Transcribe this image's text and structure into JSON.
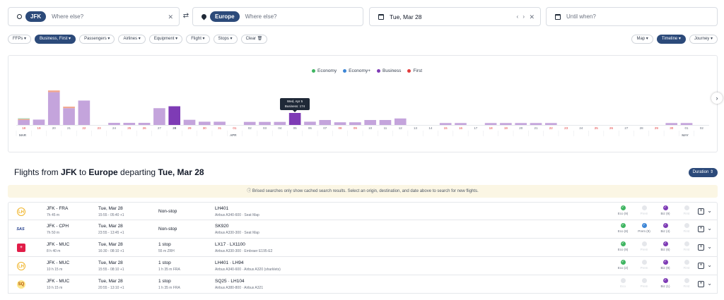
{
  "search": {
    "origin_chip": "JFK",
    "origin_placeholder": "Where else?",
    "dest_chip": "Europe",
    "dest_placeholder": "Where else?",
    "date_value": "Tue, Mar 28",
    "date_arrows": "‹ ›",
    "until_placeholder": "Until when?"
  },
  "filters": [
    "FFPs",
    "Business, First",
    "Passengers",
    "Airlines",
    "Equipment",
    "Flight",
    "Stops",
    "Clear"
  ],
  "views": [
    "Map",
    "Timeline",
    "Journey"
  ],
  "colors": {
    "economy": "#3fb561",
    "economy_plus": "#3d86d6",
    "business": "#7e3bb5",
    "first": "#e23c3c",
    "accent": "#2c4a7a"
  },
  "chart_data": {
    "type": "bar",
    "legend": [
      "Economy",
      "Economy+",
      "Business",
      "First"
    ],
    "categories": [
      "18",
      "19",
      "20",
      "21",
      "22",
      "23",
      "24",
      "25",
      "26",
      "27",
      "28",
      "29",
      "30",
      "31",
      "01",
      "02",
      "03",
      "04",
      "05",
      "06",
      "07",
      "08",
      "09",
      "10",
      "11",
      "12",
      "13",
      "14",
      "15",
      "16",
      "17",
      "18",
      "19",
      "20",
      "21",
      "22",
      "23",
      "24",
      "25",
      "26",
      "27",
      "28",
      "29",
      "30",
      "01",
      "02"
    ],
    "red_days": [
      "18",
      "19",
      "25",
      "26",
      "31",
      "01",
      "08",
      "09",
      "15",
      "16",
      "22",
      "23",
      "29",
      "30"
    ],
    "selected": "28",
    "highlight": "05",
    "month_labels": [
      {
        "at": "18",
        "text": "MAR"
      },
      {
        "at": "01",
        "text": "APR"
      },
      {
        "at": "01b",
        "text": "MAY"
      }
    ],
    "series": [
      {
        "name": "Business",
        "values": [
          26,
          28,
          172,
          88,
          128,
          0,
          11,
          11,
          11,
          88,
          98,
          27,
          17,
          17,
          0,
          16,
          16,
          16,
          63,
          17,
          26,
          14,
          14,
          26,
          26,
          34,
          0,
          0,
          10,
          10,
          0,
          10,
          10,
          10,
          10,
          10,
          0,
          0,
          0,
          0,
          0,
          0,
          0,
          10,
          10,
          0
        ]
      },
      {
        "name": "First",
        "values": [
          5,
          0,
          9,
          8,
          0,
          0,
          0,
          0,
          0,
          0,
          0,
          0,
          0,
          0,
          0,
          0,
          0,
          0,
          0,
          0,
          0,
          0,
          0,
          0,
          0,
          0,
          0,
          0,
          0,
          0,
          0,
          0,
          0,
          0,
          0,
          0,
          0,
          0,
          0,
          0,
          0,
          0,
          0,
          0,
          0,
          0
        ]
      },
      {
        "name": "Economy",
        "values": [
          4,
          0,
          0,
          0,
          0,
          0,
          0,
          0,
          0,
          0,
          0,
          0,
          0,
          0,
          0,
          0,
          0,
          0,
          0,
          0,
          0,
          0,
          0,
          0,
          0,
          0,
          0,
          0,
          0,
          0,
          0,
          0,
          0,
          0,
          0,
          0,
          0,
          0,
          0,
          0,
          0,
          0,
          0,
          0,
          0,
          0
        ]
      }
    ],
    "ylim": [
      0,
      190
    ]
  },
  "tooltip": {
    "line1": "Wed, Apr 5",
    "line2": "Business: 174"
  },
  "results": {
    "prefix": "Flights from ",
    "origin": "JFK",
    "mid": " to ",
    "dest": "Europe",
    "mid2": " departing ",
    "date": "Tue, Mar 28",
    "sort_label": "Duration"
  },
  "notice": "Brised searches only show cached search results. Select an origin, destination, and date above to search for new flights.",
  "flights": [
    {
      "logo": "LH",
      "logo_class": "lh",
      "route": "JFK - FRA",
      "duration": "7h 45 m",
      "date": "Tue, Mar 28",
      "times": "15:55 - 05:40 +1",
      "stops": "Non-stop",
      "stop_detail": "",
      "flight": "LH401",
      "equip": "Airbus A340-600  ·  Seat Map",
      "cabins": [
        {
          "label": "Eco (9)",
          "cls": "g",
          "on": true
        },
        {
          "label": "Prem",
          "cls": "b",
          "on": false
        },
        {
          "label": "Biz (9)",
          "cls": "p",
          "on": true
        },
        {
          "label": "First",
          "cls": "p",
          "on": false
        }
      ]
    },
    {
      "logo": "SAS",
      "logo_class": "sas",
      "route": "JFK - CPH",
      "duration": "7h 50 m",
      "date": "Tue, Mar 28",
      "times": "23:55 - 13:45 +1",
      "stops": "Non-stop",
      "stop_detail": "",
      "flight": "SK920",
      "equip": "Airbus A330-300  ·  Seat Map",
      "cabins": [
        {
          "label": "Eco (8)",
          "cls": "g",
          "on": true
        },
        {
          "label": "Prem (9)",
          "cls": "b",
          "on": true
        },
        {
          "label": "Biz (4)",
          "cls": "p",
          "on": true
        },
        {
          "label": "First",
          "cls": "p",
          "on": false
        }
      ]
    },
    {
      "logo": "+",
      "logo_class": "lx",
      "route": "JFK - MUC",
      "duration": "8 h 40 m",
      "date": "Tue, Mar 28",
      "times": "16:30 - 08:10 +1",
      "stops": "1 stop",
      "stop_detail": "55 m ZRH",
      "flight": "LX17  ·  LX1100",
      "equip": "Airbus A330-300  ·  Embraer E195-E2",
      "cabins": [
        {
          "label": "Eco (9)",
          "cls": "g",
          "on": true
        },
        {
          "label": "Prem",
          "cls": "b",
          "on": false
        },
        {
          "label": "Biz (6)",
          "cls": "p",
          "on": true
        },
        {
          "label": "First",
          "cls": "p",
          "on": false
        }
      ]
    },
    {
      "logo": "LH",
      "logo_class": "lh",
      "route": "JFK - MUC",
      "duration": "10 h 15 m",
      "date": "Tue, Mar 28",
      "times": "15:55 - 08:10 +1",
      "stops": "1 stop",
      "stop_detail": "1 h 35 m FRA",
      "flight": "LH401  ·  LH94",
      "equip": "Airbus A340-600  ·  Airbus A320 (sharklets)",
      "cabins": [
        {
          "label": "Eco (2)",
          "cls": "g",
          "on": true
        },
        {
          "label": "Prem",
          "cls": "b",
          "on": false
        },
        {
          "label": "Biz (9)",
          "cls": "p",
          "on": true
        },
        {
          "label": "First",
          "cls": "p",
          "on": false
        }
      ]
    },
    {
      "logo": "SQ",
      "logo_class": "sq",
      "route": "JFK - MUC",
      "duration": "10 h 15 m",
      "date": "Tue, Mar 28",
      "times": "20:55 - 13:10 +1",
      "stops": "1 stop",
      "stop_detail": "1 h 35 m FRA",
      "flight": "SQ25  ·  LH104",
      "equip": "Airbus A380-800  ·  Airbus A321",
      "cabins": [
        {
          "label": "Eco",
          "cls": "g",
          "on": false
        },
        {
          "label": "Prem",
          "cls": "b",
          "on": false
        },
        {
          "label": "Biz (1)",
          "cls": "p",
          "on": true
        },
        {
          "label": "First",
          "cls": "p",
          "on": false
        }
      ]
    }
  ]
}
